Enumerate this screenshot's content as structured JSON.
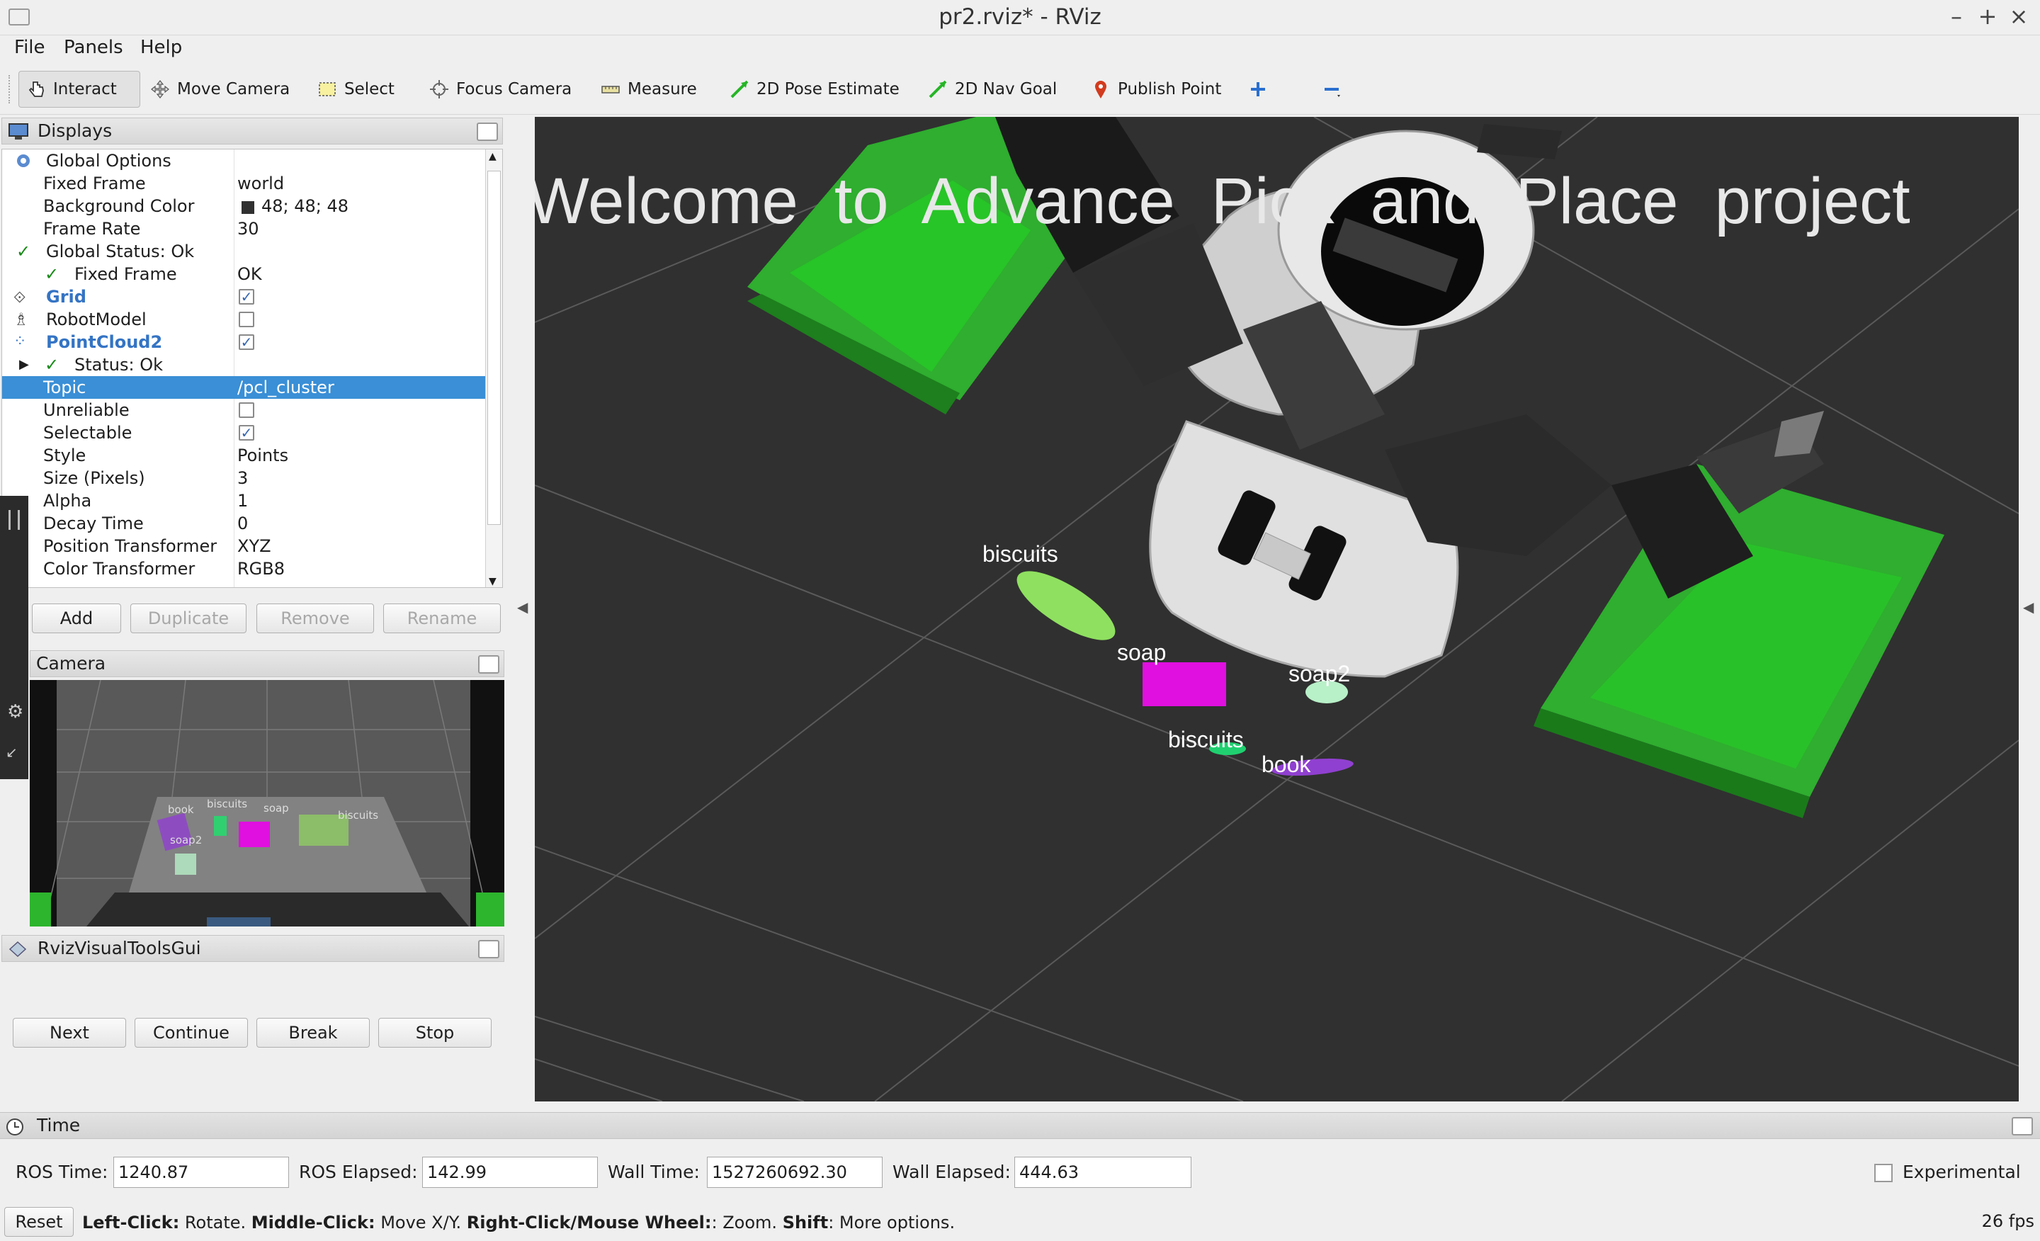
{
  "window": {
    "title": "pr2.rviz* - RViz"
  },
  "menu": [
    "File",
    "Panels",
    "Help"
  ],
  "toolbar": [
    {
      "label": "Interact",
      "icon": "hand-pointer-icon"
    },
    {
      "label": "Move Camera",
      "icon": "move-camera-icon"
    },
    {
      "label": "Select",
      "icon": "select-box-icon"
    },
    {
      "label": "Focus Camera",
      "icon": "focus-camera-icon"
    },
    {
      "label": "Measure",
      "icon": "ruler-icon"
    },
    {
      "label": "2D Pose Estimate",
      "icon": "green-arrow-icon"
    },
    {
      "label": "2D Nav Goal",
      "icon": "green-arrow-icon"
    },
    {
      "label": "Publish Point",
      "icon": "map-pin-icon"
    }
  ],
  "displays": {
    "title": "Displays",
    "rows": [
      {
        "key": "Global Options",
        "value": ""
      },
      {
        "key": "Fixed Frame",
        "value": "world"
      },
      {
        "key": "Background Color",
        "value": "48; 48; 48"
      },
      {
        "key": "Frame Rate",
        "value": "30"
      },
      {
        "key": "Global Status: Ok",
        "value": ""
      },
      {
        "key": "Fixed Frame",
        "value": "OK"
      },
      {
        "key": "Grid",
        "value": ""
      },
      {
        "key": "RobotModel",
        "value": ""
      },
      {
        "key": "PointCloud2",
        "value": ""
      },
      {
        "key": "Status: Ok",
        "value": ""
      },
      {
        "key": "Topic",
        "value": "/pcl_cluster"
      },
      {
        "key": "Unreliable",
        "value": ""
      },
      {
        "key": "Selectable",
        "value": ""
      },
      {
        "key": "Style",
        "value": "Points"
      },
      {
        "key": "Size (Pixels)",
        "value": "3"
      },
      {
        "key": "Alpha",
        "value": "1"
      },
      {
        "key": "Decay Time",
        "value": "0"
      },
      {
        "key": "Position Transformer",
        "value": "XYZ"
      },
      {
        "key": "Color Transformer",
        "value": "RGB8"
      }
    ],
    "background_color_hex": "#303030",
    "buttons": [
      "Add",
      "Duplicate",
      "Remove",
      "Rename"
    ]
  },
  "camera": {
    "title": "Camera",
    "labels": [
      "book",
      "biscuits",
      "soap",
      "biscuits",
      "soap2"
    ]
  },
  "visual_tools": {
    "title": "RvizVisualToolsGui",
    "buttons": [
      "Next",
      "Continue",
      "Break",
      "Stop"
    ]
  },
  "view3d": {
    "banner": "Welcome  to  Advance  Pick  and  Place  project",
    "objects": [
      {
        "label": "biscuits",
        "color": "#8fe060"
      },
      {
        "label": "soap",
        "color": "#e010e0"
      },
      {
        "label": "soap2",
        "color": "#b8f0c8"
      },
      {
        "label": "biscuits",
        "color": "#20d070"
      },
      {
        "label": "book",
        "color": "#9040d0"
      }
    ]
  },
  "time": {
    "title": "Time",
    "ros_time_label": "ROS Time:",
    "ros_time": "1240.87",
    "ros_elapsed_label": "ROS Elapsed:",
    "ros_elapsed": "142.99",
    "wall_time_label": "Wall Time:",
    "wall_time": "1527260692.30",
    "wall_elapsed_label": "Wall Elapsed:",
    "wall_elapsed": "444.63",
    "experimental": "Experimental"
  },
  "status": {
    "reset": "Reset",
    "hint_left_b": "Left-Click:",
    "hint_left": " Rotate. ",
    "hint_mid_b": "Middle-Click:",
    "hint_mid": " Move X/Y. ",
    "hint_right_b": "Right-Click/Mouse Wheel:",
    "hint_right": ": Zoom. ",
    "hint_shift_b": "Shift",
    "hint_shift": ": More options.",
    "fps": "26 fps"
  }
}
